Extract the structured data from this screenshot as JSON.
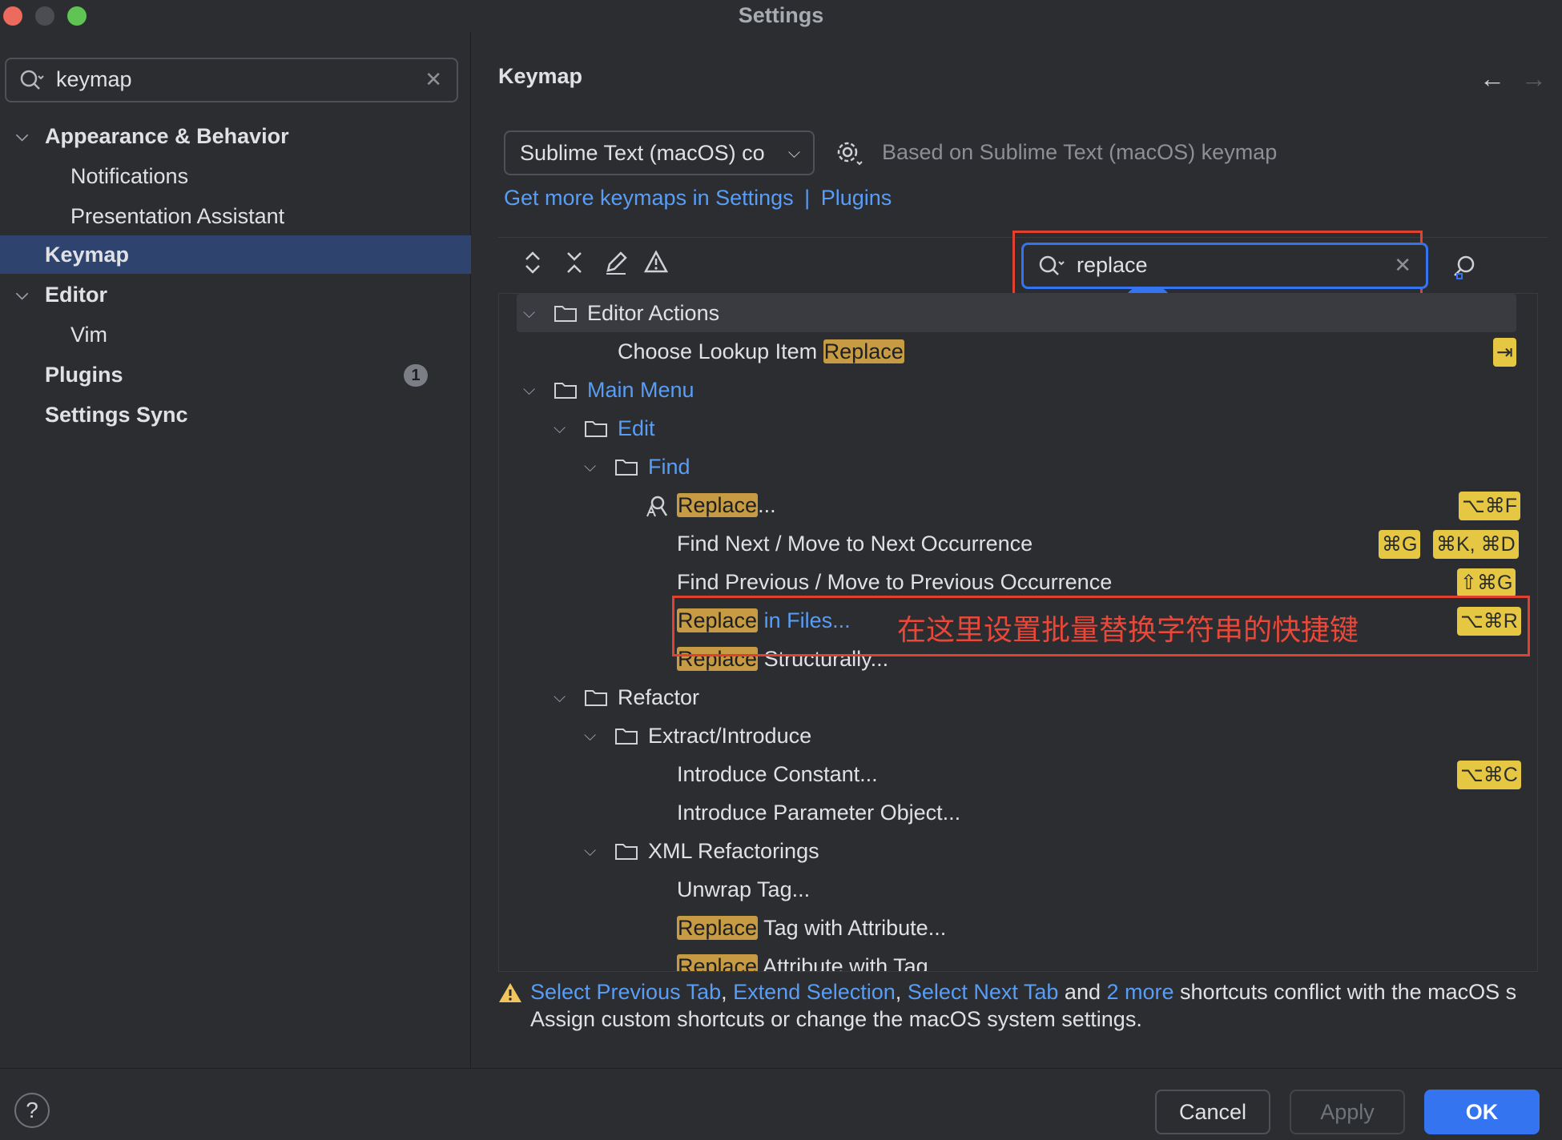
{
  "window": {
    "title": "Settings"
  },
  "sidebar": {
    "search_value": "keymap",
    "items": [
      {
        "label": "Appearance & Behavior"
      },
      {
        "label": "Notifications"
      },
      {
        "label": "Presentation Assistant"
      },
      {
        "label": "Keymap"
      },
      {
        "label": "Editor"
      },
      {
        "label": "Vim"
      },
      {
        "label": "Plugins",
        "badge": "1"
      },
      {
        "label": "Settings Sync"
      }
    ]
  },
  "main": {
    "title": "Keymap",
    "back_arrow": "←",
    "forward_arrow": "→",
    "keymap_select": "Sublime Text (macOS) co",
    "based_on": "Based on Sublime Text (macOS) keymap",
    "link_get_more": "Get more keymaps in Settings",
    "link_sep": "|",
    "link_plugins": "Plugins",
    "search_value": "replace"
  },
  "tree": {
    "editor_actions": "Editor Actions",
    "choose_lookup_prefix": "Choose Lookup Item ",
    "choose_lookup_hl": "Replace",
    "choose_lookup_sc": "⇥",
    "main_menu": "Main Menu",
    "edit": "Edit",
    "find": "Find",
    "replace_hl": "Replace",
    "replace_rest": "...",
    "replace_sc": "⌥⌘F",
    "find_next": "Find Next / Move to Next Occurrence",
    "find_next_sc1": "⌘G",
    "find_next_sc2": "⌘K, ⌘D",
    "find_prev": "Find Previous / Move to Previous Occurrence",
    "find_prev_sc": "⇧⌘G",
    "rif_hl": "Replace",
    "rif_rest": " in Files...",
    "rif_sc": "⌥⌘R",
    "rs_hl": "Replace",
    "rs_rest": " Structurally...",
    "refactor": "Refactor",
    "extract": "Extract/Introduce",
    "intro_const": "Introduce Constant...",
    "intro_const_sc": "⌥⌘C",
    "intro_param": "Introduce Parameter Object...",
    "xml_ref": "XML Refactorings",
    "unwrap": "Unwrap Tag...",
    "rtwa_hl": "Replace",
    "rtwa_rest": " Tag with Attribute...",
    "raw_hl": "Replace",
    "raw_rest": " Attribute with Tag"
  },
  "annotation": "在这里设置批量替换字符串的快捷键",
  "warning": {
    "link1": "Select Previous Tab",
    "comma1": ", ",
    "link2": "Extend Selection",
    "comma2": ", ",
    "link3": "Select Next Tab",
    "and": " and ",
    "link4": "2 more",
    "rest": " shortcuts conflict with the macOS s",
    "line2": "Assign custom shortcuts or change the macOS system settings."
  },
  "footer": {
    "help": "?",
    "cancel": "Cancel",
    "apply": "Apply",
    "ok": "OK"
  },
  "colors": {
    "accent": "#3574f0",
    "highlight": "#c69b44",
    "shortcut": "#e6c744",
    "annotation": "#e0422f"
  }
}
